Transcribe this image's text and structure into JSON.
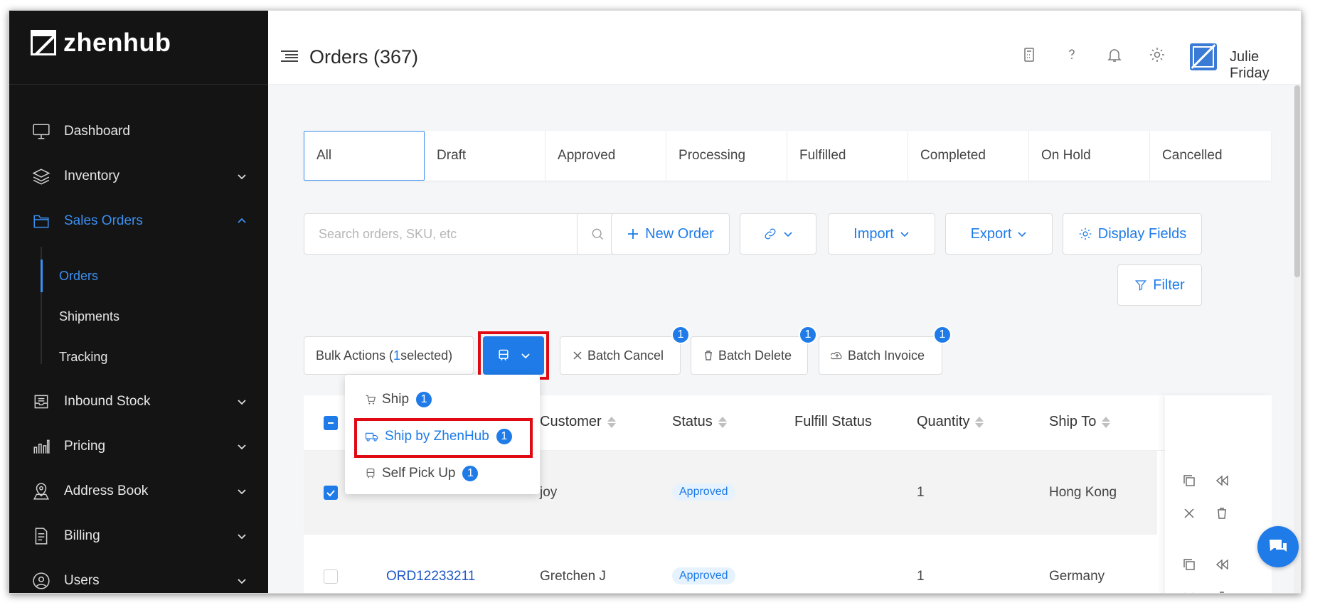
{
  "brand": {
    "name": "zhenhub"
  },
  "sidebar": {
    "items": [
      {
        "label": "Dashboard",
        "icon": "monitor-icon"
      },
      {
        "label": "Inventory",
        "icon": "layers-icon"
      },
      {
        "label": "Sales Orders",
        "icon": "folder-icon"
      },
      {
        "label": "Inbound Stock",
        "icon": "inbox-icon"
      },
      {
        "label": "Pricing",
        "icon": "bar-chart-icon"
      },
      {
        "label": "Address Book",
        "icon": "map-pin-icon"
      },
      {
        "label": "Billing",
        "icon": "document-icon"
      },
      {
        "label": "Users",
        "icon": "globe-user-icon"
      }
    ],
    "sub_items": [
      {
        "label": "Orders"
      },
      {
        "label": "Shipments"
      },
      {
        "label": "Tracking"
      }
    ]
  },
  "header": {
    "title": "Orders (367)",
    "user": "Julie Friday"
  },
  "tabs": [
    "All",
    "Draft",
    "Approved",
    "Processing",
    "Fulfilled",
    "Completed",
    "On Hold",
    "Cancelled"
  ],
  "search": {
    "placeholder": "Search orders, SKU, etc",
    "value": ""
  },
  "toolbar": {
    "new_order": "New Order",
    "import": "Import",
    "export": "Export",
    "display_fields": "Display Fields",
    "filter": "Filter"
  },
  "bulk": {
    "prefix": "Bulk Actions (",
    "count": "1",
    "suffix": " selected)",
    "batch_cancel": "Batch Cancel",
    "batch_delete": "Batch Delete",
    "batch_invoice": "Batch Invoice",
    "badge": "1"
  },
  "ship_menu": {
    "items": [
      {
        "label": "Ship",
        "badge": "1"
      },
      {
        "label": "Ship by ZhenHub",
        "badge": "1"
      },
      {
        "label": "Self Pick Up",
        "badge": "1"
      }
    ]
  },
  "table": {
    "columns": [
      "Customer",
      "Status",
      "Fulfill Status",
      "Quantity",
      "Ship To"
    ],
    "rows": [
      {
        "order": "",
        "customer": "joy",
        "status": "Approved",
        "fulfill": "",
        "quantity": "1",
        "ship_to": "Hong Kong"
      },
      {
        "order": "ORD12233211",
        "customer": "Gretchen J",
        "status": "Approved",
        "fulfill": "",
        "quantity": "1",
        "ship_to": "Germany"
      }
    ]
  },
  "colors": {
    "accent": "#1e7be8",
    "sidebar_bg": "#141414",
    "highlight": "#e00a14"
  }
}
